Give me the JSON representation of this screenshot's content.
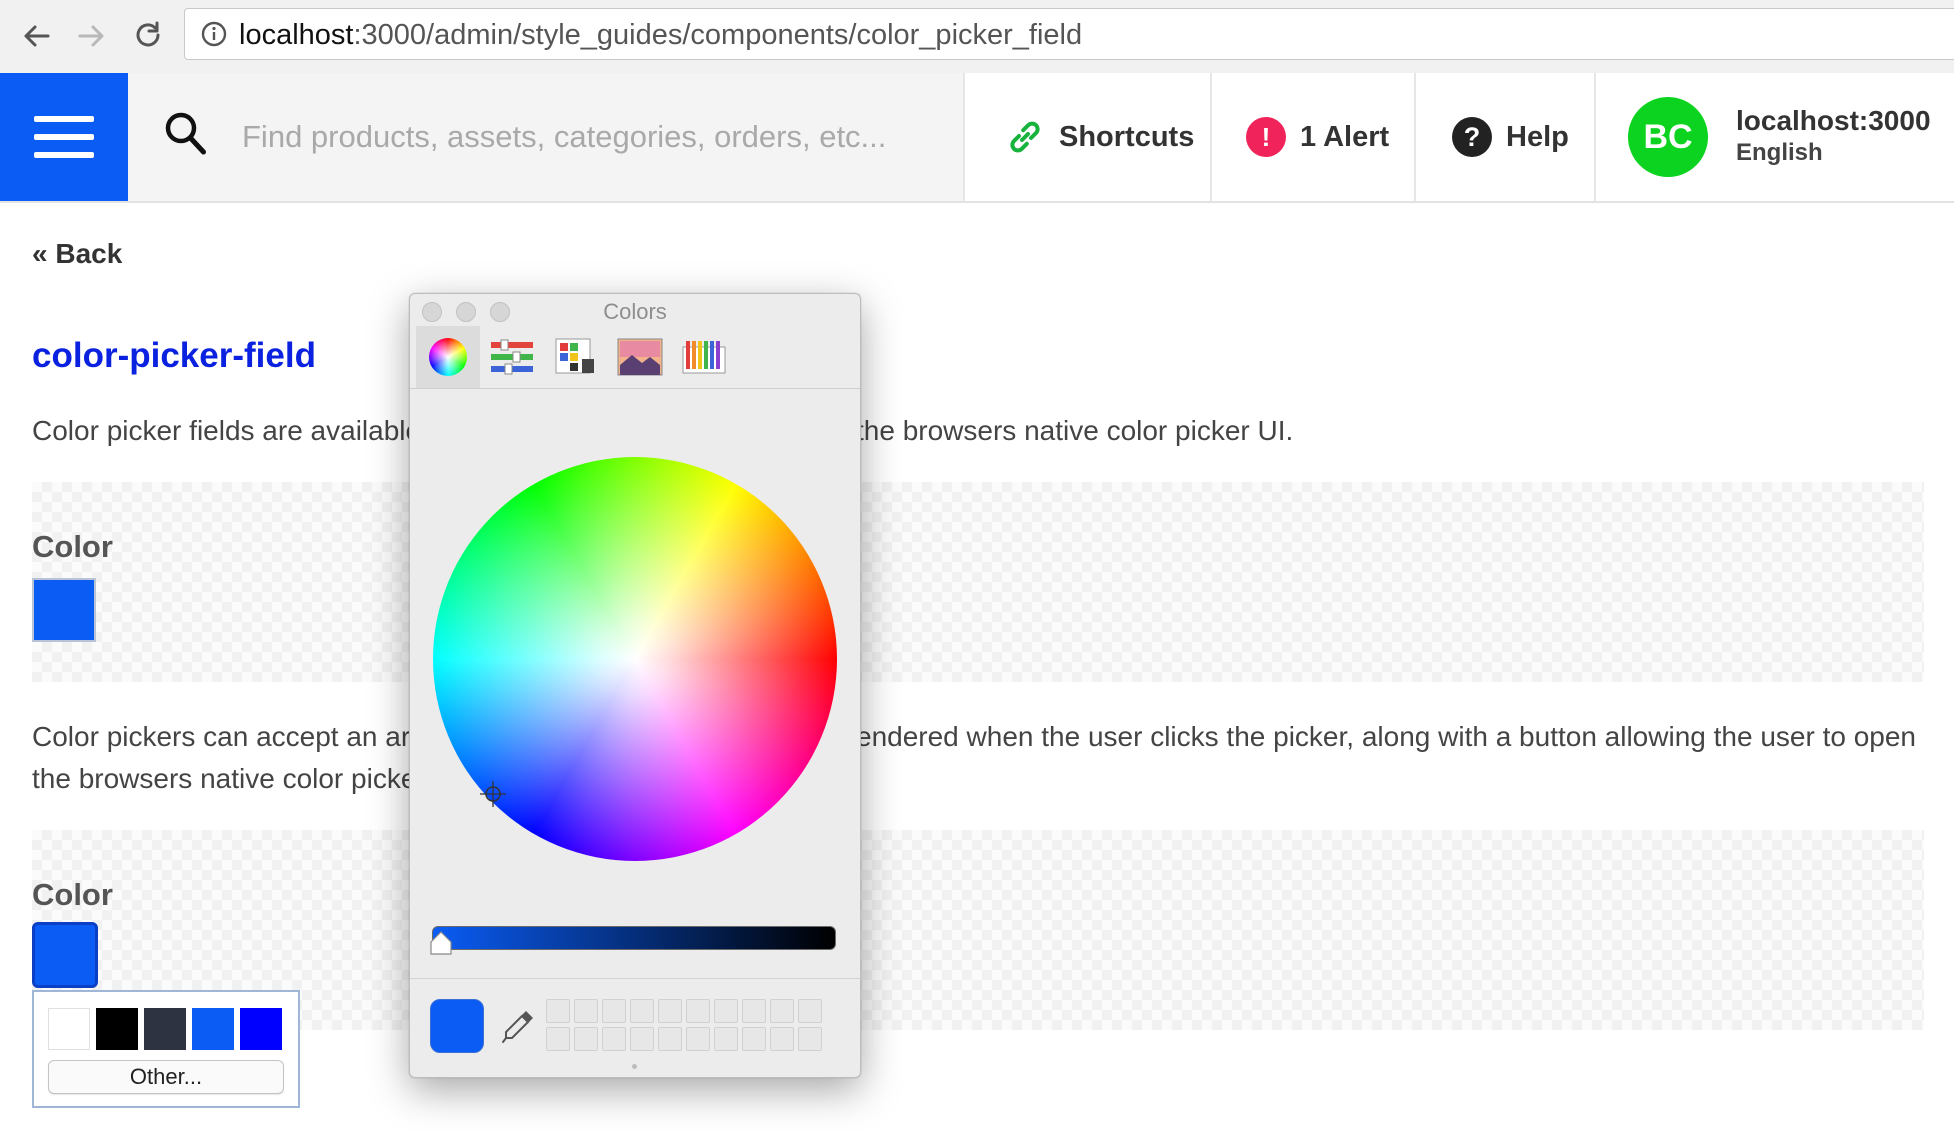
{
  "browser": {
    "url_host": "localhost",
    "url_path": ":3000/admin/style_guides/components/color_picker_field"
  },
  "header": {
    "search_placeholder": "Find products, assets, categories, orders, etc...",
    "shortcuts_label": "Shortcuts",
    "alert_label": "1 Alert",
    "alert_icon_text": "!",
    "help_label": "Help",
    "help_icon_text": "?",
    "avatar_initials": "BC",
    "account_host": "localhost:3000",
    "account_language": "English",
    "colors": {
      "brand": "#0a5cf5",
      "avatar": "#0bd31f",
      "alert": "#f0245a"
    }
  },
  "page": {
    "back_label": "« Back",
    "title": "color-picker-field",
    "desc1_left": "Color picker fields are available",
    "desc1_right": "the browsers native color picker UI.",
    "field1_label": "Color",
    "desc2_line1_left": "Color pickers can accept an arr",
    "desc2_line1_right": "endered when the user clicks the picker, along with a button allowing the user to open",
    "desc2_line2_left": "the browsers native color picker",
    "field2_label": "Color",
    "selected_color": "#0a5cf5",
    "palette_colors": [
      "#ffffff",
      "#000000",
      "#2d3340",
      "#0a5cf5",
      "#0000ff"
    ],
    "other_button": "Other..."
  },
  "colors_panel": {
    "title": "Colors",
    "tabs": [
      "color-wheel",
      "color-sliders",
      "color-palettes",
      "image-palettes",
      "pencils"
    ],
    "active_tab": "color-wheel",
    "current_color": "#0a5cf5",
    "brightness": 1.0
  }
}
